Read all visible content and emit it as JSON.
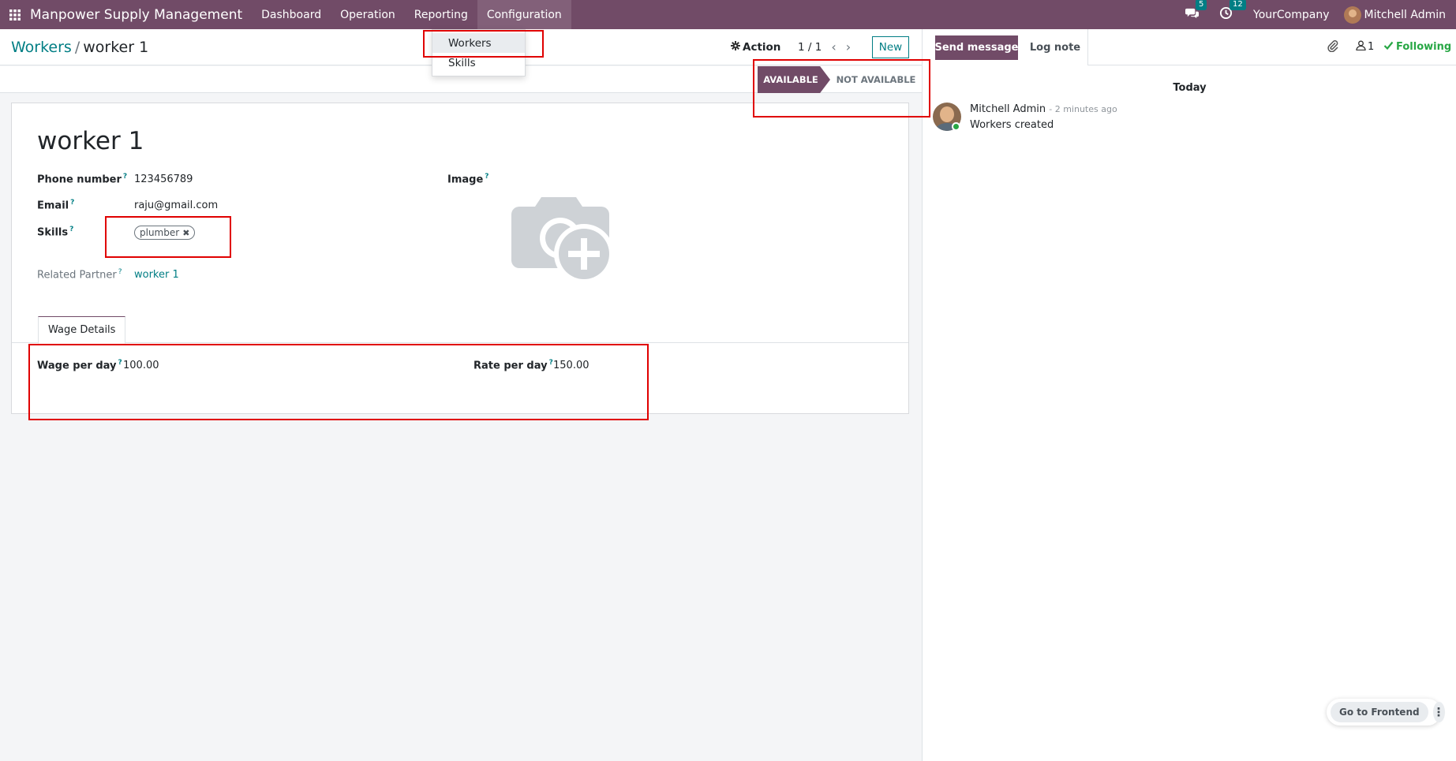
{
  "navbar": {
    "app_name": "Manpower Supply Management",
    "menu": [
      "Dashboard",
      "Operation",
      "Reporting",
      "Configuration"
    ],
    "messages_badge": "5",
    "activities_badge": "12",
    "company": "YourCompany",
    "user": "Mitchell Admin",
    "colors": {
      "brand": "#714b67",
      "accent": "#017e84"
    }
  },
  "dropdown": {
    "items": [
      "Workers",
      "Skills"
    ]
  },
  "control_panel": {
    "breadcrumb_parent": "Workers",
    "breadcrumb_separator": "/",
    "breadcrumb_current": "worker 1",
    "action_label": "Action",
    "pager": "1 / 1",
    "new_label": "New"
  },
  "statusbar": {
    "available": "AVAILABLE",
    "not_available": "NOT AVAILABLE"
  },
  "form": {
    "title": "worker 1",
    "phone_label": "Phone number",
    "phone_value": "123456789",
    "email_label": "Email",
    "email_value": "raju@gmail.com",
    "skills_label": "Skills",
    "skills": [
      "plumber"
    ],
    "partner_label": "Related Partner",
    "partner_value": "worker 1",
    "image_label": "Image",
    "help_mark": "?",
    "tab_label": "Wage Details",
    "wage_label": "Wage per day",
    "wage_value": "100.00",
    "rate_label": "Rate per day",
    "rate_value": "150.00"
  },
  "chatter": {
    "send_message": "Send message",
    "log_note": "Log note",
    "followers_count": "1",
    "following": "Following",
    "day_separator": "Today",
    "message_author": "Mitchell Admin",
    "message_time": "- 2 minutes ago",
    "message_body": "Workers created"
  },
  "floating": {
    "frontend_label": "Go to Frontend"
  }
}
